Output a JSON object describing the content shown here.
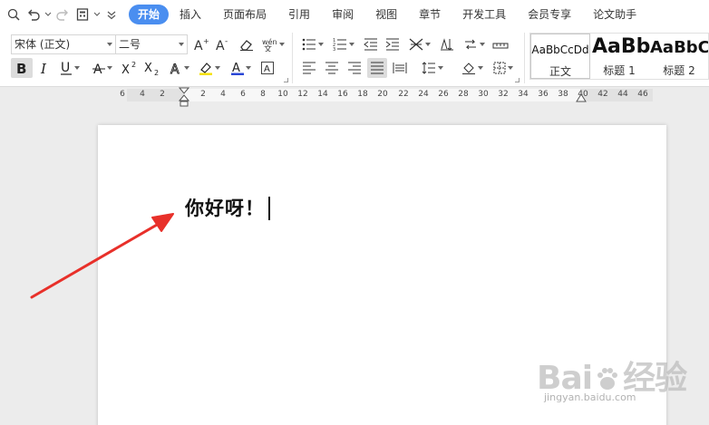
{
  "menu": {
    "tabs": [
      {
        "label": "开始",
        "active": true
      },
      {
        "label": "插入"
      },
      {
        "label": "页面布局"
      },
      {
        "label": "引用"
      },
      {
        "label": "审阅"
      },
      {
        "label": "视图"
      },
      {
        "label": "章节"
      },
      {
        "label": "开发工具"
      },
      {
        "label": "会员专享"
      },
      {
        "label": "论文助手"
      }
    ],
    "accent_color": "#4a8ef0"
  },
  "ribbon": {
    "font_name": "宋体 (正文)",
    "font_size": "二号",
    "font_color_bar": "#2a47d6",
    "highlight_color_bar": "#f5e100",
    "styles": [
      {
        "sample": "AaBbCcDd",
        "name": "正文"
      },
      {
        "sample": "AaBb",
        "name": "标题 1"
      },
      {
        "sample": "AaBbC",
        "name": "标题 2"
      }
    ]
  },
  "ruler": {
    "ticks": [
      "6",
      "4",
      "2",
      "2",
      "4",
      "6",
      "8",
      "10",
      "12",
      "14",
      "16",
      "18",
      "20",
      "22",
      "24",
      "26",
      "28",
      "30",
      "32",
      "34",
      "36",
      "38",
      "40",
      "42",
      "44",
      "46"
    ]
  },
  "document": {
    "text": "你好呀！"
  },
  "watermark": {
    "brand": "Bai",
    "brand_tail": "经验",
    "url": "jingyan.baidu.com"
  },
  "annotation": {
    "arrow_color": "#e8302a"
  }
}
